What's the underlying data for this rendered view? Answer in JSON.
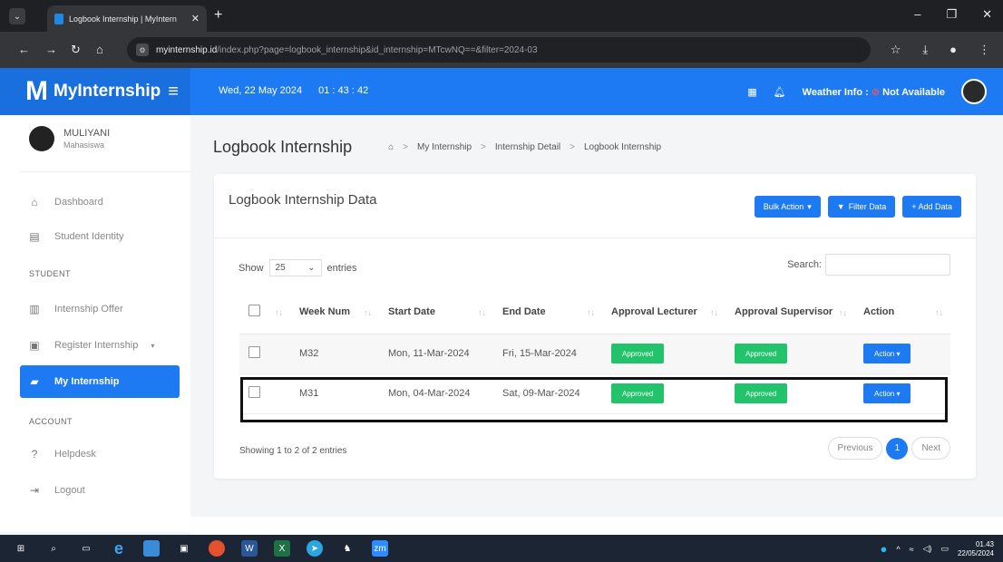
{
  "browser": {
    "tab_title": "Logbook Internship | MyIntern",
    "url_host": "myinternship.id",
    "url_path": "/index.php?page=logbook_internship&id_internship=MTcwNQ==&filter=2024-03"
  },
  "header": {
    "brand": "MyInternship",
    "date": "Wed, 22 May 2024",
    "time": "01 : 43 : 42",
    "weather_label": "Weather Info :",
    "weather_value": "Not Available"
  },
  "sidebar": {
    "user_name": "MULIYANI",
    "user_role": "Mahasiswa",
    "items_top": [
      {
        "label": "Dashboard",
        "icon": "home-icon"
      },
      {
        "label": "Student Identity",
        "icon": "id-card-icon"
      }
    ],
    "section_student": "STUDENT",
    "items_student": [
      {
        "label": "Internship Offer",
        "icon": "building-icon"
      },
      {
        "label": "Register Internship",
        "icon": "form-icon"
      },
      {
        "label": "My Internship",
        "icon": "briefcase-icon"
      }
    ],
    "section_account": "ACCOUNT",
    "items_account": [
      {
        "label": "Helpdesk",
        "icon": "question-icon"
      },
      {
        "label": "Logout",
        "icon": "logout-icon"
      }
    ]
  },
  "page": {
    "title": "Logbook Internship",
    "breadcrumbs": [
      "My Internship",
      "Internship Detail",
      "Logbook Internship"
    ]
  },
  "card": {
    "title": "Logbook Internship Data",
    "bulk_action": "Bulk Action",
    "filter": "Filter Data",
    "add": "+ Add Data",
    "show_label": "Show",
    "entries_value": "25",
    "entries_label": "entries",
    "search_label": "Search:",
    "info": "Showing 1 to 2 of 2 entries",
    "prev": "Previous",
    "page": "1",
    "next": "Next"
  },
  "table": {
    "headers": [
      "Week Num",
      "Start Date",
      "End Date",
      "Approval Lecturer",
      "Approval Supervisor",
      "Action"
    ],
    "rows": [
      {
        "week": "M32",
        "start": "Mon, 11-Mar-2024",
        "end": "Fri, 15-Mar-2024",
        "lecturer": "Approved",
        "supervisor": "Approved",
        "action": "Action"
      },
      {
        "week": "M31",
        "start": "Mon, 04-Mar-2024",
        "end": "Sat, 09-Mar-2024",
        "lecturer": "Approved",
        "supervisor": "Approved",
        "action": "Action"
      }
    ]
  },
  "taskbar": {
    "time": "01.43",
    "date": "22/05/2024"
  }
}
